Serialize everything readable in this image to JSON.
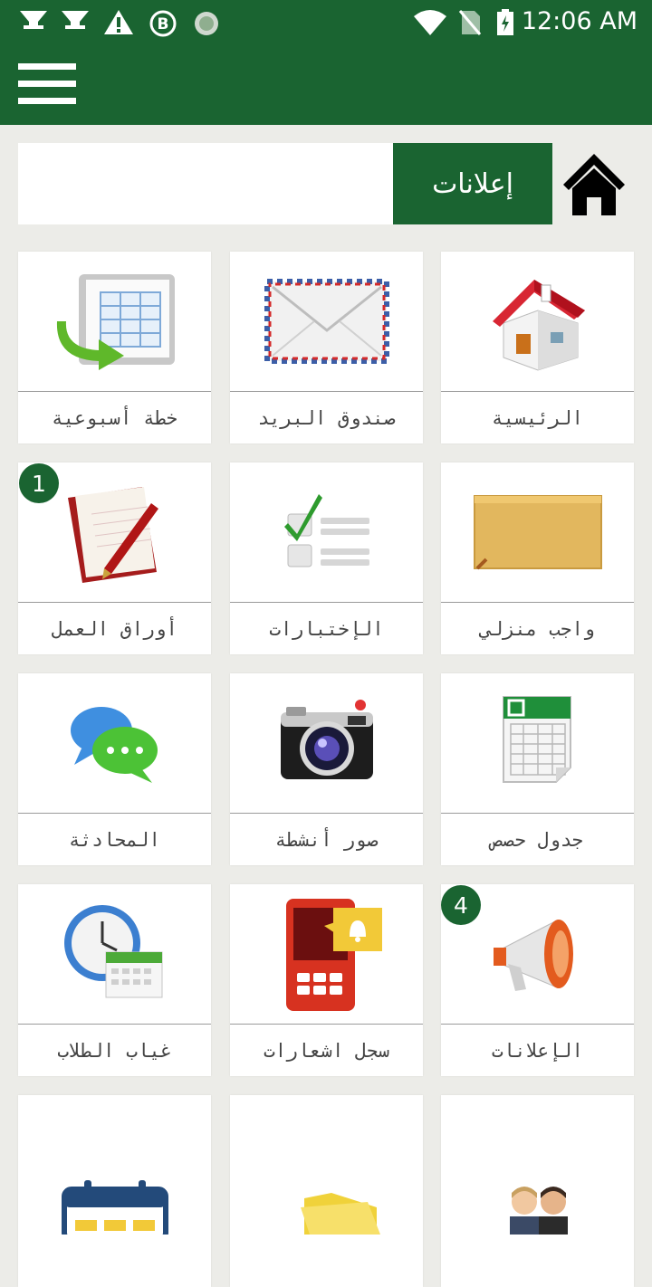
{
  "status_bar": {
    "time": "12:06 AM",
    "left_icons": [
      "signal-icon",
      "signal-icon",
      "warning-icon",
      "bluetooth-b-icon",
      "sync-icon"
    ],
    "right_icons": [
      "wifi-icon",
      "no-sim-icon",
      "battery-icon"
    ]
  },
  "toolbar": {
    "menu_icon": "hamburger-menu-icon"
  },
  "announcement_bar": {
    "label": "إعلانات",
    "home_icon": "home-icon"
  },
  "tiles": [
    {
      "label": "الرئيسية",
      "icon": "house-icon"
    },
    {
      "label": "صندوق البريد",
      "icon": "envelope-icon"
    },
    {
      "label": "خطة أسبوعية",
      "icon": "weekly-plan-icon"
    },
    {
      "label": "واجب منزلي",
      "icon": "folder-icon"
    },
    {
      "label": "الإختبارات",
      "icon": "checklist-icon"
    },
    {
      "label": "أوراق العمل",
      "icon": "notebook-icon",
      "badge": "1"
    },
    {
      "label": "جدول حصص",
      "icon": "spreadsheet-icon"
    },
    {
      "label": "صور أنشطة",
      "icon": "camera-icon"
    },
    {
      "label": "المحادثة",
      "icon": "chat-bubbles-icon"
    },
    {
      "label": "الإعلانات",
      "icon": "megaphone-icon",
      "badge": "4"
    },
    {
      "label": "سجل اشعارات",
      "icon": "phone-notification-icon"
    },
    {
      "label": "غياب الطلاب",
      "icon": "clock-calendar-icon"
    },
    {
      "label": "",
      "icon": "people-icon"
    },
    {
      "label": "",
      "icon": "open-folder-icon"
    },
    {
      "label": "",
      "icon": "calendar-icon"
    }
  ],
  "colors": {
    "primary": "#1a6431",
    "background": "#ecece8"
  }
}
